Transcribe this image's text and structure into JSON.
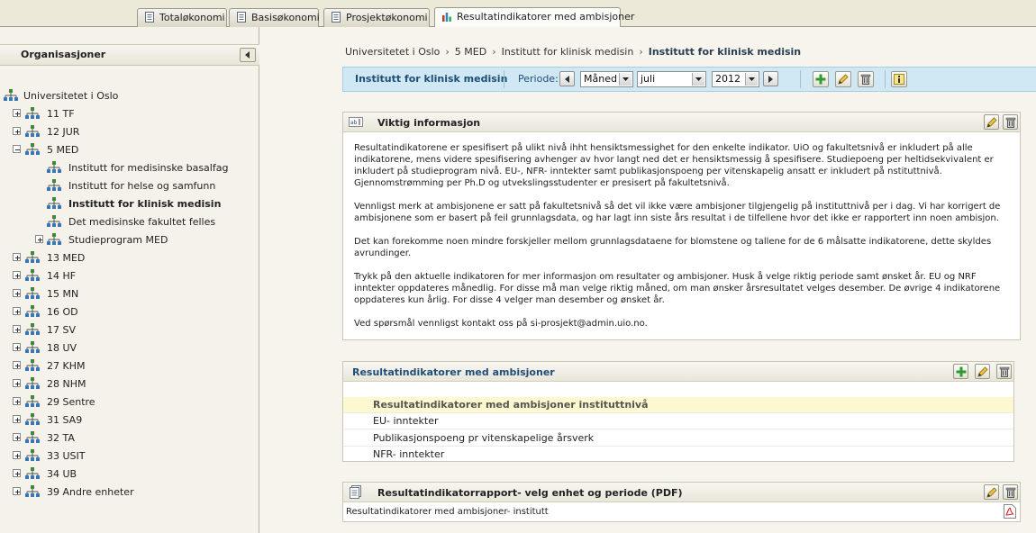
{
  "tabs": [
    {
      "label": "Totaløkonomi",
      "icon": "document-icon",
      "active": false
    },
    {
      "label": "Basisøkonomi",
      "icon": "document-icon",
      "active": false
    },
    {
      "label": "Prosjektøkonomi",
      "icon": "document-icon",
      "active": false
    },
    {
      "label": "Resultatindikatorer med ambisjoner",
      "icon": "bar-chart-icon",
      "active": true
    }
  ],
  "sidebar": {
    "title": "Organisasjoner",
    "root": "Universitetet i Oslo",
    "nodes": [
      {
        "label": "11 TF",
        "expander": "plus"
      },
      {
        "label": "12 JUR",
        "expander": "plus"
      },
      {
        "label": "5 MED",
        "expander": "minus"
      },
      {
        "label": "Institutt for medisinske basalfag",
        "expander": "none"
      },
      {
        "label": "Institutt for helse og samfunn",
        "expander": "none"
      },
      {
        "label": "Institutt for klinisk medisin",
        "expander": "none",
        "selected": true
      },
      {
        "label": "Det medisinske fakultet felles",
        "expander": "none"
      },
      {
        "label": "Studieprogram MED",
        "expander": "plus"
      },
      {
        "label": "13 MED",
        "expander": "plus"
      },
      {
        "label": "14 HF",
        "expander": "plus"
      },
      {
        "label": "15 MN",
        "expander": "plus"
      },
      {
        "label": "16 OD",
        "expander": "plus"
      },
      {
        "label": "17 SV",
        "expander": "plus"
      },
      {
        "label": "18 UV",
        "expander": "plus"
      },
      {
        "label": "27 KHM",
        "expander": "plus"
      },
      {
        "label": "28 NHM",
        "expander": "plus"
      },
      {
        "label": "29 Sentre",
        "expander": "plus"
      },
      {
        "label": "31 SA9",
        "expander": "plus"
      },
      {
        "label": "32 TA",
        "expander": "plus"
      },
      {
        "label": "33 USIT",
        "expander": "plus"
      },
      {
        "label": "34 UB",
        "expander": "plus"
      },
      {
        "label": "39 Andre enheter",
        "expander": "plus"
      }
    ]
  },
  "breadcrumb": {
    "items": [
      "Universitetet i Oslo",
      "5 MED",
      "Institutt for klinisk medisin"
    ],
    "current": "Institutt for klinisk medisin"
  },
  "toolbar": {
    "unit_title": "Institutt for klinisk medisin",
    "period_label": "Periode:",
    "period_type": "Måned",
    "month": "juli",
    "year": "2012"
  },
  "info_panel": {
    "title": "Viktig informasjon",
    "paragraphs": [
      "Resultatindikatorene er spesifisert på ulikt nivå ihht hensiktsmessighet for den enkelte indikator. UiO og fakultetsnivå er inkludert på alle indikatorene, mens videre spesifisering avhenger av hvor langt ned det er hensiktsmessig å spesifisere. Studiepoeng per heltidsekvivalent er inkludert på studieprogram nivå. EU-, NFR- inntekter samt publikasjonspoeng per vitenskapelig ansatt er inkludert på nstituttnivå. Gjennomstrømming per Ph.D og utvekslingsstudenter er presisert på fakultetsnivå.",
      "Vennligst merk at ambisjonene er satt på fakultetsnivå så det vil ikke være ambisjoner tilgjengelig på instituttnivå per i dag. Vi har korrigert de ambisjonene som er basert på feil grunnlagsdata, og har lagt inn siste års resultat i de tilfellene hvor det ikke er rapportert inn noen ambisjon.",
      "Det kan forekomme noen mindre forskjeller mellom grunnlagsdataene for blomstene og tallene for de 6 målsatte indikatorene, dette skyldes avrundinger.",
      "Trykk på den aktuelle indikatoren for mer informasjon om resultater og ambisjoner. Husk å velge riktig periode samt ønsket år. EU og NRF inntekter oppdateres månedlig. For disse må man velge riktig måned, om man ønsker årsresultatet velges desember. De øvrige 4 indikatorene oppdateres kun årlig. For disse 4 velger man desember og ønsket år.",
      "Ved spørsmål vennligst kontakt oss på si-prosjekt@admin.uio.no."
    ]
  },
  "indicators_panel": {
    "title": "Resultatindikatorer med ambisjoner",
    "group_header": "Resultatindikatorer med ambisjoner instituttnivå",
    "rows": [
      "EU- inntekter",
      "Publikasjonspoeng pr vitenskapelige årsverk",
      "NFR- inntekter"
    ]
  },
  "report_panel": {
    "title": "Resultatindikatorrapport- velg enhet og periode (PDF)",
    "item": "Resultatindikatorer med ambisjoner- institutt"
  },
  "colors": {
    "toolbar_bg": "#d0e8f4",
    "toolbar_text": "#1f4e79",
    "highlight_row": "#fdf8cf"
  }
}
